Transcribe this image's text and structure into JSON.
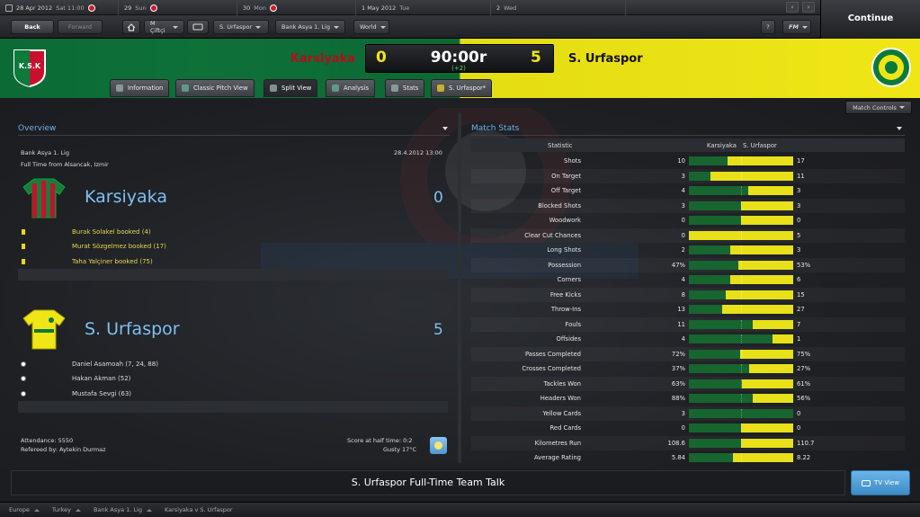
{
  "datebar": {
    "cells": [
      {
        "date": "28 Apr 2012",
        "day": "Sat 11:00"
      },
      {
        "date": "29",
        "day": "Sun"
      },
      {
        "date": "30",
        "day": "Mon"
      },
      {
        "date": "1 May 2012",
        "day": "Tue"
      },
      {
        "date": "2",
        "day": "Wed"
      }
    ]
  },
  "continue_label": "Continue",
  "nav": {
    "back": "Back",
    "forward": "Forward",
    "manager": "M Çiftçi",
    "club": "S. Urfaspor",
    "competition": "Bank Asya 1. Lig",
    "world": "World",
    "help": "?",
    "fm": "FM"
  },
  "match": {
    "home_team": "Karsiyaka",
    "away_team": "S. Urfaspor",
    "home_score": "0",
    "away_score": "5",
    "clock": "90:00r",
    "added_time": "(+2)",
    "home_crest_text": "K.S.K",
    "colors": {
      "home": "#0f7a3d",
      "away": "#f0e617",
      "home_text": "#b0101a"
    }
  },
  "tabs": [
    {
      "label": "Information",
      "icon": "info-icon"
    },
    {
      "label": "Classic Pitch View",
      "icon": "pitch-icon"
    },
    {
      "label": "Split View",
      "icon": "split-icon"
    },
    {
      "label": "Analysis",
      "icon": "analysis-icon"
    },
    {
      "label": "Stats",
      "icon": "stats-icon"
    },
    {
      "label": "S. Urfaspor*",
      "icon": "team-icon"
    }
  ],
  "match_controls": "Match Controls",
  "overview": {
    "title": "Overview",
    "competition": "Bank Asya 1. Lig",
    "date": "28.4.2012 13:00",
    "venue": "Full Time from Alsancak, Izmir",
    "home": {
      "name": "Karsiyaka",
      "score": "0",
      "events": [
        "Burak Solakel booked (4)",
        "Murat Sözgelmez booked (17)",
        "Taha Yalçiner booked (75)"
      ]
    },
    "away": {
      "name": "S. Urfaspor",
      "score": "5",
      "events": [
        "Daniel Asamoah (7, 24, 88)",
        "Hakan Akman (52)",
        "Mustafa Sevgi (63)"
      ]
    },
    "attendance": "Attendance: 5550",
    "referee": "Refereed by: Aytekin Durmaz",
    "halftime": "Score at half time: 0:2",
    "weather": "Gusty 17°C"
  },
  "stats": {
    "title": "Match Stats",
    "col_statistic": "Statistic",
    "col_home": "Karsiyaka",
    "col_away": "S. Urfaspor",
    "rows": [
      {
        "label": "Shots",
        "home": "10",
        "away": "17",
        "away_share": 0.63
      },
      {
        "label": "On Target",
        "home": "3",
        "away": "11",
        "away_share": 0.79
      },
      {
        "label": "Off Target",
        "home": "4",
        "away": "3",
        "away_share": 0.43
      },
      {
        "label": "Blocked Shots",
        "home": "3",
        "away": "3",
        "away_share": 0.5
      },
      {
        "label": "Woodwork",
        "home": "0",
        "away": "0",
        "away_share": 0.5
      },
      {
        "label": "Clear Cut Chances",
        "home": "0",
        "away": "5",
        "away_share": 1.0
      },
      {
        "label": "Long Shots",
        "home": "2",
        "away": "3",
        "away_share": 0.6
      },
      {
        "label": "Possession",
        "home": "47%",
        "away": "53%",
        "away_share": 0.53
      },
      {
        "label": "Corners",
        "home": "4",
        "away": "6",
        "away_share": 0.6
      },
      {
        "label": "Free Kicks",
        "home": "8",
        "away": "15",
        "away_share": 0.65
      },
      {
        "label": "Throw-Ins",
        "home": "13",
        "away": "27",
        "away_share": 0.68
      },
      {
        "label": "Fouls",
        "home": "11",
        "away": "7",
        "away_share": 0.39
      },
      {
        "label": "Offsides",
        "home": "4",
        "away": "1",
        "away_share": 0.2
      },
      {
        "label": "Passes Completed",
        "home": "72%",
        "away": "75%",
        "away_share": 0.51
      },
      {
        "label": "Crosses Completed",
        "home": "37%",
        "away": "27%",
        "away_share": 0.42
      },
      {
        "label": "Tackles Won",
        "home": "63%",
        "away": "61%",
        "away_share": 0.49
      },
      {
        "label": "Headers Won",
        "home": "88%",
        "away": "56%",
        "away_share": 0.39
      },
      {
        "label": "Yellow Cards",
        "home": "3",
        "away": "0",
        "away_share": 0.0
      },
      {
        "label": "Red Cards",
        "home": "0",
        "away": "0",
        "away_share": 0.5
      },
      {
        "label": "Kilometres Run",
        "home": "108.6",
        "away": "110.7",
        "away_share": 0.5
      },
      {
        "label": "Average Rating",
        "home": "5.84",
        "away": "8.22",
        "away_share": 0.58
      }
    ]
  },
  "team_talk": "S. Urfaspor Full-Time Team Talk",
  "tv_view": "TV View",
  "breadcrumbs": [
    "Europe",
    "Turkey",
    "Bank Asya 1. Lig",
    "Karsiyaka v S. Urfaspor"
  ]
}
